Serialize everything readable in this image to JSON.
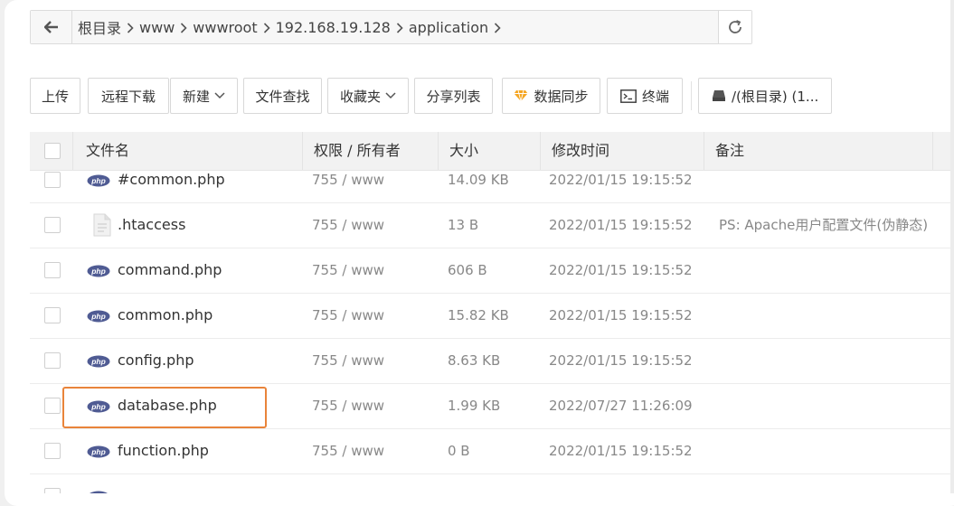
{
  "pathbar": {
    "crumbs": [
      "根目录",
      "www",
      "wwwroot",
      "192.168.19.128",
      "application"
    ]
  },
  "toolbar": {
    "upload": "上传",
    "remote_download": "远程下载",
    "new": "新建",
    "file_search": "文件查找",
    "favorites": "收藏夹",
    "share_list": "分享列表",
    "sync": "数据同步",
    "terminal": "终端",
    "disk": "/(根目录) (1..."
  },
  "table": {
    "headers": {
      "name": "文件名",
      "perm": "权限 / 所有者",
      "size": "大小",
      "mtime": "修改时间",
      "note": "备注"
    },
    "rows": [
      {
        "icon": "php-icon",
        "name": "#common.php",
        "perm": "755 / www",
        "size": "14.09 KB",
        "mtime": "2022/01/15 19:15:52",
        "note": ""
      },
      {
        "icon": "file-icon",
        "name": ".htaccess",
        "perm": "755 / www",
        "size": "13 B",
        "mtime": "2022/01/15 19:15:52",
        "note": "PS: Apache用户配置文件(伪静态)"
      },
      {
        "icon": "php-icon",
        "name": "command.php",
        "perm": "755 / www",
        "size": "606 B",
        "mtime": "2022/01/15 19:15:52",
        "note": ""
      },
      {
        "icon": "php-icon",
        "name": "common.php",
        "perm": "755 / www",
        "size": "15.82 KB",
        "mtime": "2022/01/15 19:15:52",
        "note": ""
      },
      {
        "icon": "php-icon",
        "name": "config.php",
        "perm": "755 / www",
        "size": "8.63 KB",
        "mtime": "2022/01/15 19:15:52",
        "note": ""
      },
      {
        "icon": "php-icon",
        "name": "database.php",
        "perm": "755 / www",
        "size": "1.99 KB",
        "mtime": "2022/07/27 11:26:09",
        "note": ""
      },
      {
        "icon": "php-icon",
        "name": "function.php",
        "perm": "755 / www",
        "size": "0 B",
        "mtime": "2022/01/15 19:15:52",
        "note": ""
      },
      {
        "icon": "php-icon",
        "name": "",
        "perm": "",
        "size": "",
        "mtime": "",
        "note": ""
      }
    ]
  },
  "colors": {
    "highlight": "#e9843a",
    "php_icon": "#4f5b93",
    "sync_icon": "#f5a623"
  }
}
